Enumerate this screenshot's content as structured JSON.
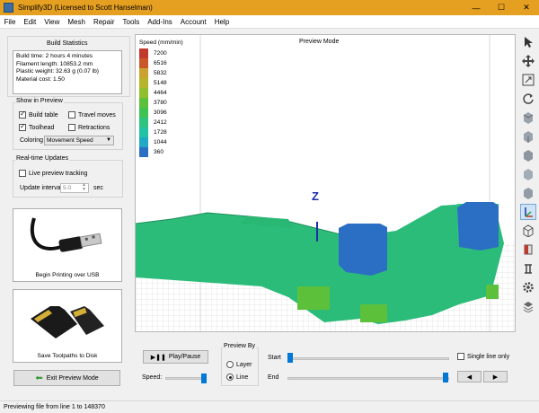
{
  "window": {
    "title": "Simplify3D (Licensed to Scott Hanselman)",
    "minimize": "—",
    "maximize": "☐",
    "close": "✕"
  },
  "menu": [
    "File",
    "Edit",
    "View",
    "Mesh",
    "Repair",
    "Tools",
    "Add-Ins",
    "Account",
    "Help"
  ],
  "build_stats": {
    "heading": "Build Statistics",
    "lines": [
      "Build time: 2 hours 4 minutes",
      "Filament length: 10853.2 mm",
      "Plastic weight: 32.63 g (0.07 lb)",
      "Material cost: 1.50"
    ]
  },
  "show_in_preview": {
    "heading": "Show in Preview",
    "build_table": "Build table",
    "travel_moves": "Travel moves",
    "toolhead": "Toolhead",
    "retractions": "Retractions",
    "coloring_label": "Coloring",
    "coloring_value": "Movement Speed"
  },
  "realtime": {
    "heading": "Real-time Updates",
    "live_tracking": "Live preview tracking",
    "interval_label": "Update interval",
    "interval_value": "5.0",
    "interval_unit": "sec"
  },
  "usb_button": "Begin Printing over USB",
  "disk_button": "Save Toolpaths to Disk",
  "exit_button": "Exit Preview Mode",
  "viewport": {
    "mode": "Preview Mode",
    "axis_label": "Z"
  },
  "speed_legend": {
    "title": "Speed (mm/min)",
    "entries": [
      {
        "value": "7200",
        "color": "#c0392b"
      },
      {
        "value": "6516",
        "color": "#c9572a"
      },
      {
        "value": "5832",
        "color": "#c9a22f"
      },
      {
        "value": "5148",
        "color": "#b5b42a"
      },
      {
        "value": "4464",
        "color": "#8fbf2e"
      },
      {
        "value": "3780",
        "color": "#5cc03a"
      },
      {
        "value": "3096",
        "color": "#3ec251"
      },
      {
        "value": "2412",
        "color": "#2ec37f"
      },
      {
        "value": "1728",
        "color": "#22c2a4"
      },
      {
        "value": "1044",
        "color": "#1fa9c4"
      },
      {
        "value": "360",
        "color": "#2b6fc4"
      }
    ]
  },
  "playback": {
    "play_pause": "Play/Pause",
    "speed_label": "Speed:",
    "preview_by": "Preview By",
    "layer": "Layer",
    "line": "Line",
    "start": "Start",
    "end": "End",
    "single_line_only": "Single line only",
    "prev": "◀",
    "next": "▶"
  },
  "status": "Previewing file from line 1 to 148370",
  "colors": {
    "titlebar": "#e6a021",
    "accent": "#0078d7",
    "model_green": "#2ec37f",
    "model_blue": "#2b6fc4"
  }
}
